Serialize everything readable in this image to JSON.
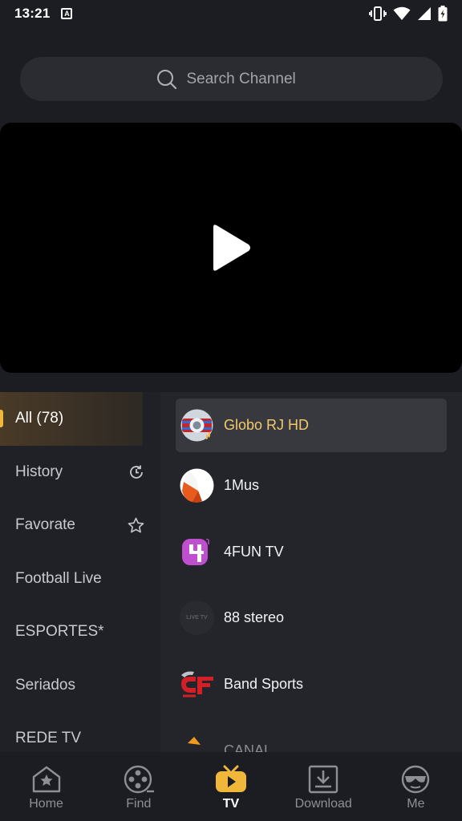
{
  "status_bar": {
    "time": "13:21",
    "notification_icon": "A"
  },
  "search": {
    "placeholder": "Search Channel"
  },
  "categories": [
    {
      "label": "All (78)",
      "icon": null
    },
    {
      "label": "History",
      "icon": "history-icon"
    },
    {
      "label": "Favorate",
      "icon": "star-icon"
    },
    {
      "label": "Football Live",
      "icon": null
    },
    {
      "label": "ESPORTES*",
      "icon": null
    },
    {
      "label": "Seriados",
      "icon": null
    },
    {
      "label": "REDE TV",
      "icon": null
    }
  ],
  "channels": [
    {
      "name": "Globo RJ HD",
      "logo": "globo-logo"
    },
    {
      "name": "1Mus",
      "logo": "1mus-logo"
    },
    {
      "name": "4FUN TV",
      "logo": "4fun-logo"
    },
    {
      "name": "88 stereo",
      "logo": "88stereo-logo",
      "logo_text": "LIVE TV"
    },
    {
      "name": "Band Sports",
      "logo": "band-sports-logo"
    },
    {
      "name": "CANAL...",
      "logo": "partial-logo"
    }
  ],
  "nav": {
    "home": "Home",
    "find": "Find",
    "tv": "TV",
    "download": "Download",
    "me": "Me"
  },
  "colors": {
    "accent": "#f0b73a",
    "active_channel_text": "#f3c96b",
    "background": "#1c1d22"
  }
}
